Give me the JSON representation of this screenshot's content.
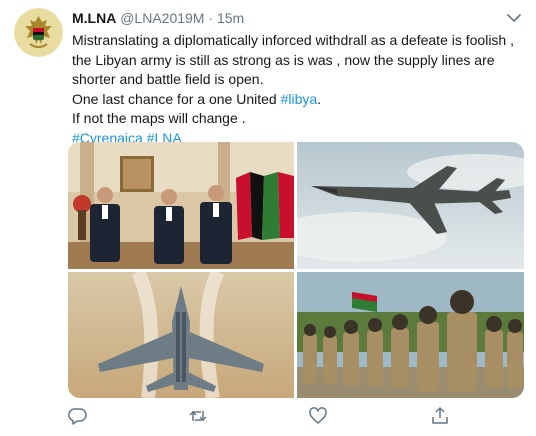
{
  "tweet": {
    "author": {
      "display_name": "M.LNA",
      "handle": "@LNA2019M",
      "separator": "·",
      "time": "15m",
      "avatar_icon": "libyan-eagle-emblem-icon"
    },
    "body": {
      "paragraph_1": "Mistranslating a diplomatically inforced withdrall as a defeate is foolish , the Libyan army is still as strong as is was , now the supply lines are shorter and battle field is open.",
      "line_2_text": "One last chance for a one United ",
      "line_2_hashtag": "#libya",
      "line_2_end": ".",
      "line_3": "If not the maps will change .",
      "hashtag_1": "#Cyrenaica",
      "hashtag_2": "#LNA"
    },
    "media": [
      {
        "description_icon": "officials-meeting-photo"
      },
      {
        "description_icon": "fighter-jet-in-flight-photo"
      },
      {
        "description_icon": "fighter-jet-underside-photo"
      },
      {
        "description_icon": "soldiers-in-formation-photo"
      }
    ],
    "actions": [
      "reply-icon",
      "retweet-icon",
      "like-icon",
      "share-icon"
    ],
    "colors": {
      "link": "#1b95e0",
      "secondary_text": "#657786",
      "primary_text": "#14171a",
      "icon_gray": "#657786"
    }
  }
}
